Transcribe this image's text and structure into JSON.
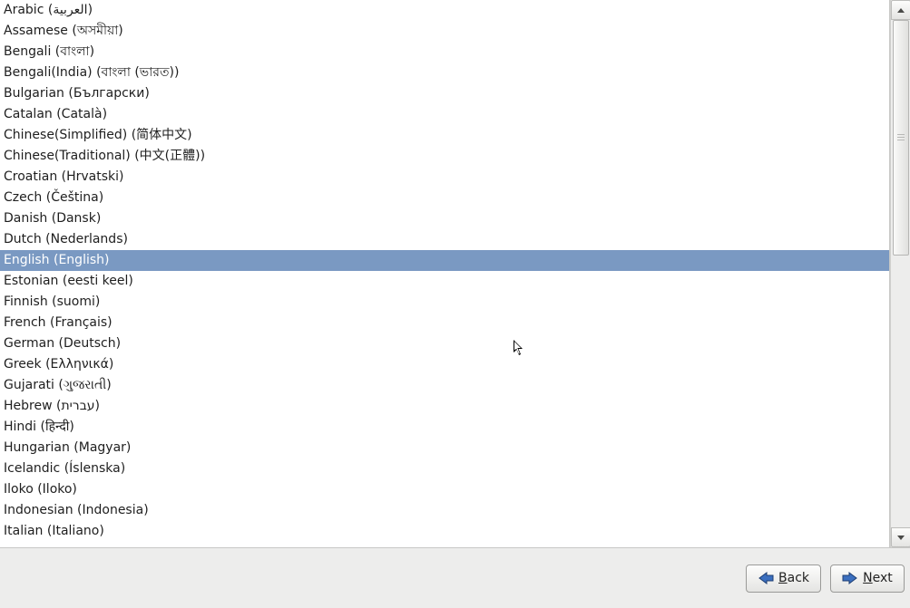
{
  "list": {
    "selected_index": 12,
    "items": [
      "Arabic (العربية)",
      "Assamese (অসমীয়া)",
      "Bengali (বাংলা)",
      "Bengali(India) (বাংলা (ভারত))",
      "Bulgarian (Български)",
      "Catalan (Català)",
      "Chinese(Simplified) (简体中文)",
      "Chinese(Traditional) (中文(正體))",
      "Croatian (Hrvatski)",
      "Czech (Čeština)",
      "Danish (Dansk)",
      "Dutch (Nederlands)",
      "English (English)",
      "Estonian (eesti keel)",
      "Finnish (suomi)",
      "French (Français)",
      "German (Deutsch)",
      "Greek (Ελληνικά)",
      "Gujarati (ગુજરાતી)",
      "Hebrew (עברית)",
      "Hindi (हिन्दी)",
      "Hungarian (Magyar)",
      "Icelandic (Íslenska)",
      "Iloko (Iloko)",
      "Indonesian (Indonesia)",
      "Italian (Italiano)"
    ]
  },
  "buttons": {
    "back": "Back",
    "next": "Next"
  }
}
